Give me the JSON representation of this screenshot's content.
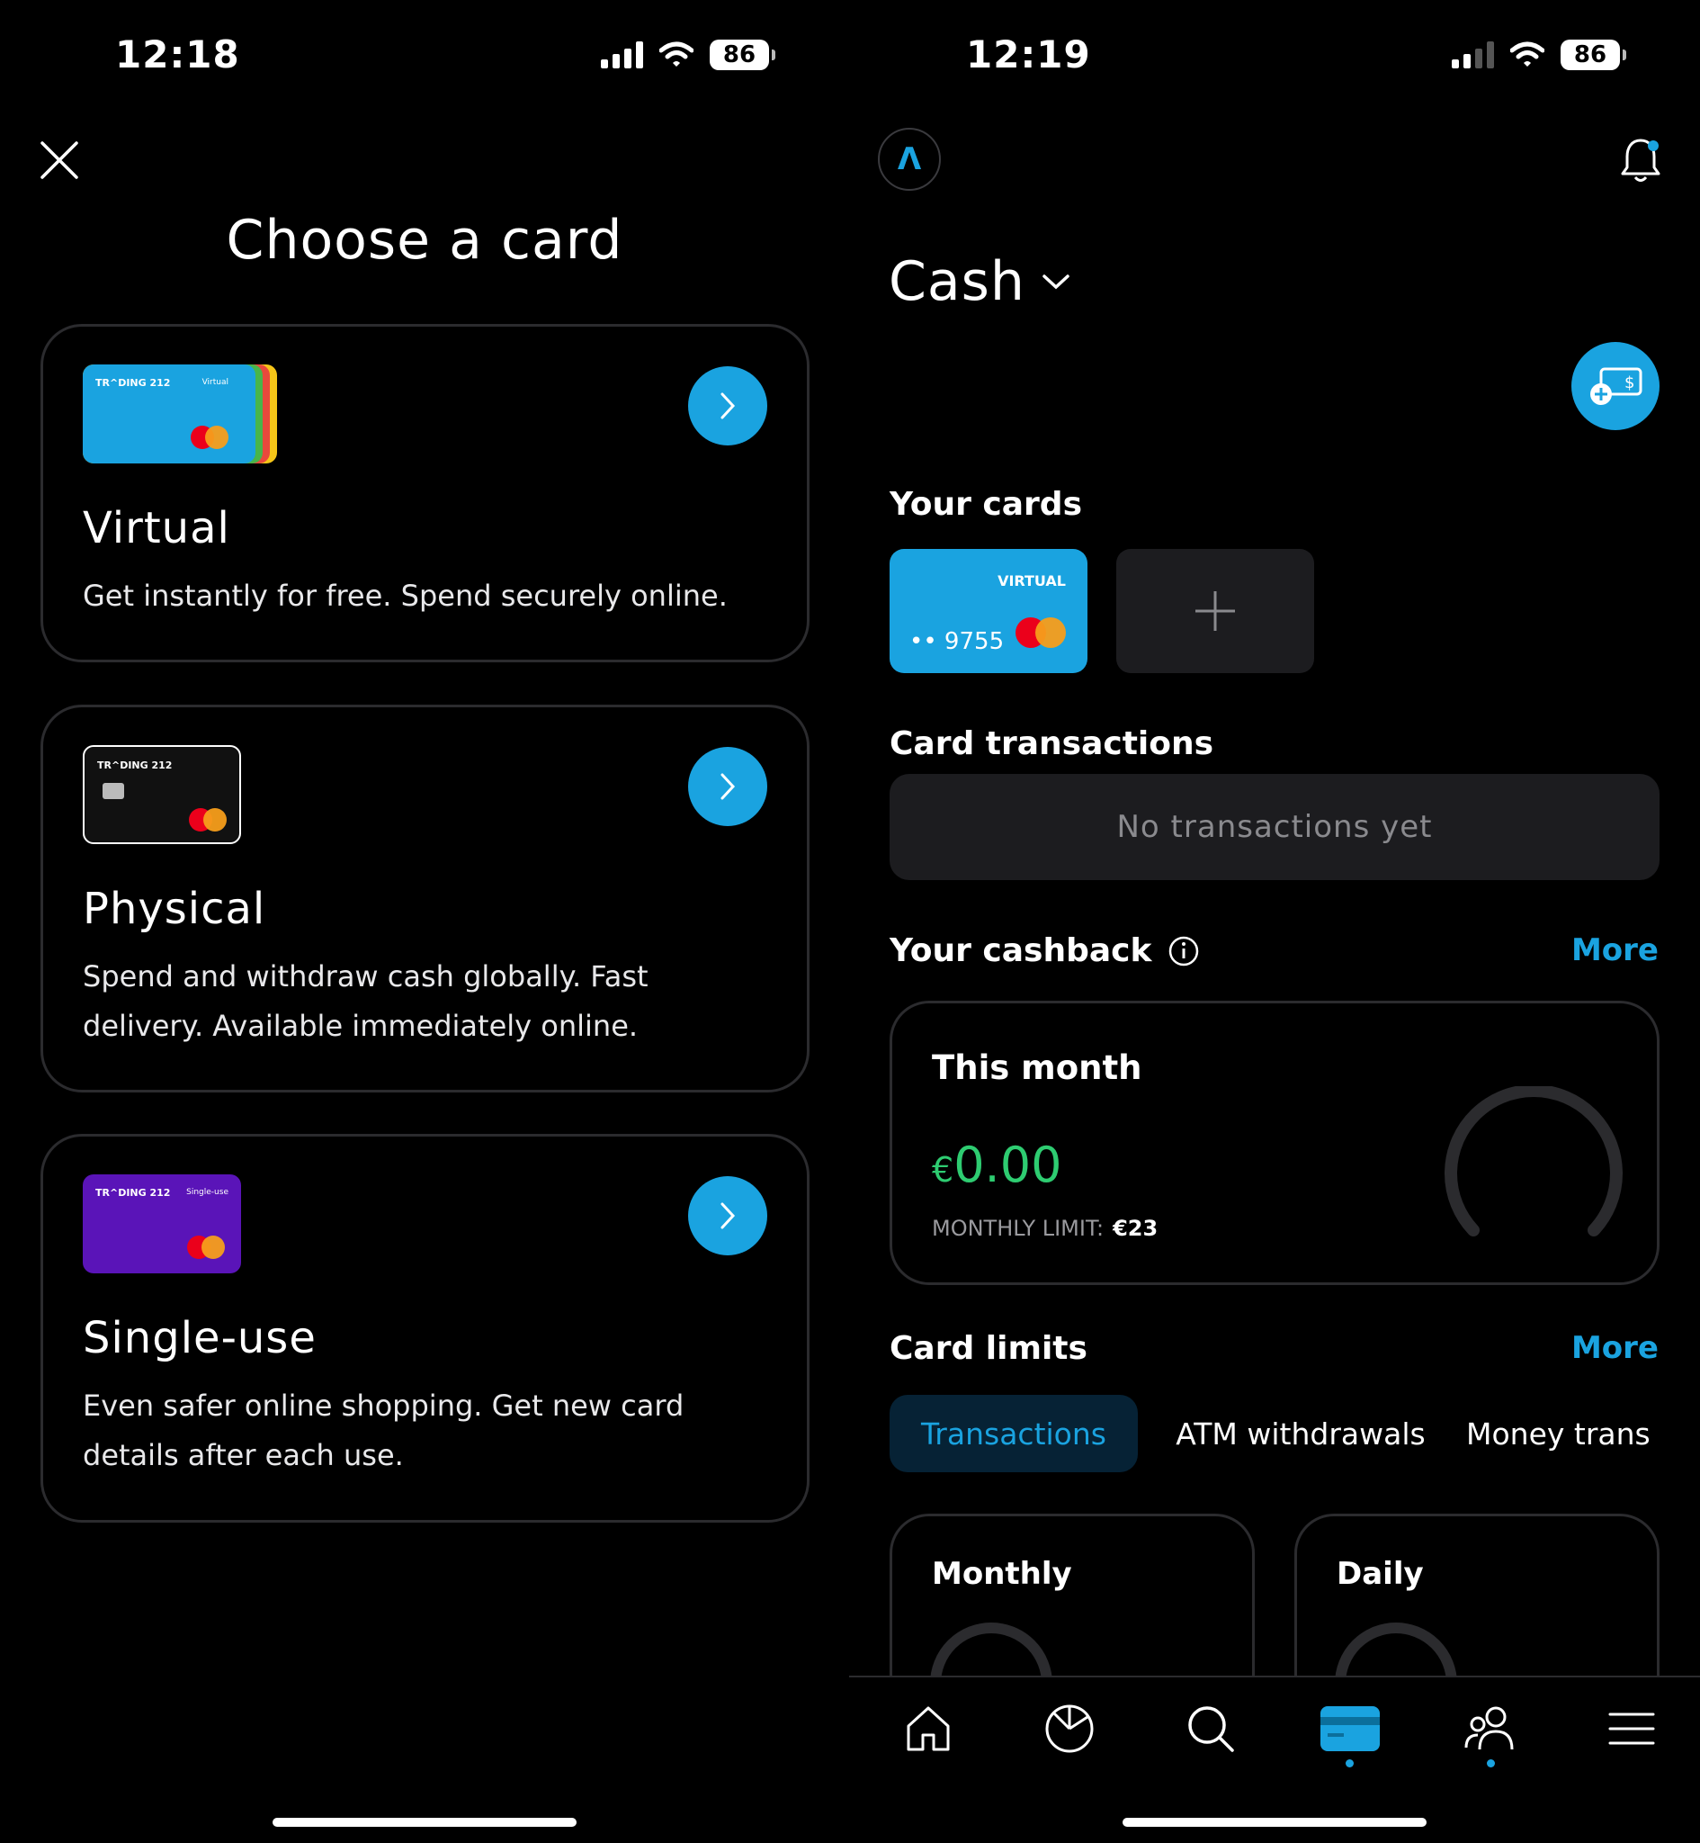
{
  "left_screen": {
    "status_bar": {
      "time": "12:18",
      "battery": "86"
    },
    "title": "Choose a card",
    "options": [
      {
        "card_brand": "TR^DING 212",
        "card_tag": "Virtual",
        "title": "Virtual",
        "description": "Get instantly for free. Spend securely online."
      },
      {
        "card_brand": "TR^DING 212",
        "card_tag": "",
        "title": "Physical",
        "description": "Spend and withdraw cash globally. Fast delivery. Available immediately online."
      },
      {
        "card_brand": "TR^DING 212",
        "card_tag": "Single-use",
        "title": "Single-use",
        "description": "Even safer online shopping. Get new card details after each use."
      }
    ]
  },
  "right_screen": {
    "status_bar": {
      "time": "12:19",
      "battery": "86"
    },
    "logo_letter": "Λ",
    "account_selector": "Cash",
    "your_cards": {
      "title": "Your cards",
      "card": {
        "tag": "VIRTUAL",
        "masked_number": "•• 9755"
      }
    },
    "card_transactions": {
      "title": "Card transactions",
      "empty_text": "No transactions yet"
    },
    "cashback": {
      "title": "Your cashback",
      "more": "More",
      "period": "This month",
      "currency": "€",
      "amount": "0.00",
      "limit_label": "MONTHLY LIMIT:",
      "limit_value": "€23",
      "progress_fraction": 0
    },
    "card_limits": {
      "title": "Card limits",
      "more": "More",
      "tabs": [
        "Transactions",
        "ATM withdrawals",
        "Money trans"
      ],
      "active_tab": "Transactions",
      "panels": [
        "Monthly",
        "Daily"
      ]
    },
    "bottom_nav": [
      "home-icon",
      "portfolio-pie-icon",
      "search-icon",
      "card-icon",
      "people-icon",
      "menu-icon"
    ],
    "active_nav": "card-icon"
  },
  "colors": {
    "accent": "#1AA3E0",
    "positive": "#2ECC71",
    "surface": "#1C1C1F",
    "border": "#2B2B2E"
  }
}
